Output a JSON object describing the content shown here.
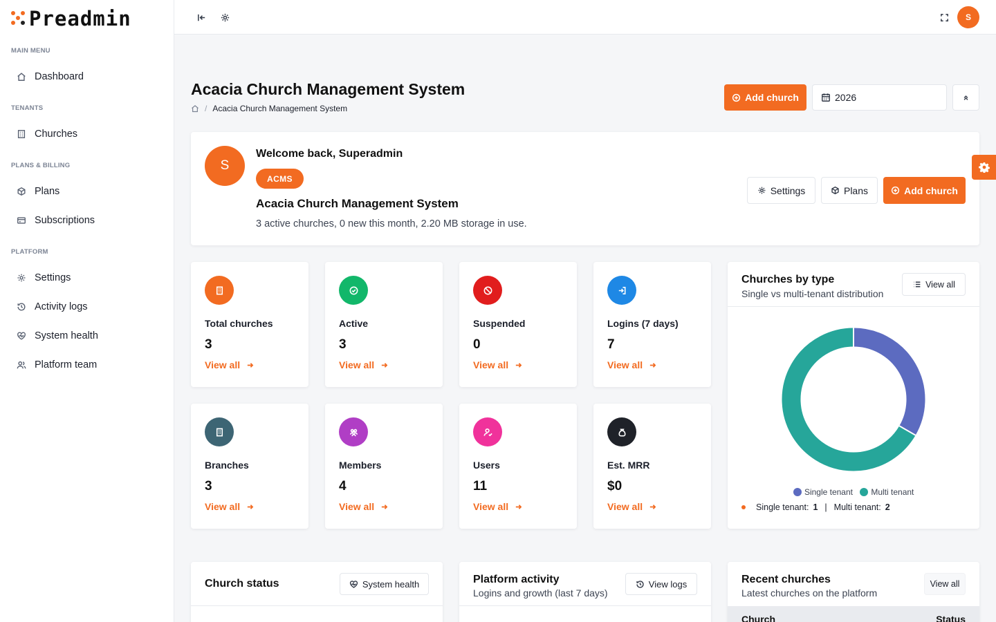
{
  "brand": {
    "name": "Preadmin",
    "accent": "#f26b21"
  },
  "sidebar": {
    "sections": [
      {
        "label": "MAIN MENU",
        "items": [
          {
            "label": "Dashboard",
            "icon": "home-icon"
          }
        ]
      },
      {
        "label": "TENANTS",
        "items": [
          {
            "label": "Churches",
            "icon": "building-icon"
          }
        ]
      },
      {
        "label": "PLANS & BILLING",
        "items": [
          {
            "label": "Plans",
            "icon": "package-icon"
          },
          {
            "label": "Subscriptions",
            "icon": "credit-card-icon"
          }
        ]
      },
      {
        "label": "PLATFORM",
        "items": [
          {
            "label": "Settings",
            "icon": "gear-icon"
          },
          {
            "label": "Activity logs",
            "icon": "history-icon"
          },
          {
            "label": "System health",
            "icon": "heartbeat-icon"
          },
          {
            "label": "Platform team",
            "icon": "users-icon"
          }
        ]
      }
    ]
  },
  "header": {
    "user_initial": "S"
  },
  "page": {
    "title": "Acacia Church Management System",
    "breadcrumb_current": "Acacia Church Management System",
    "add_church_label": "Add church",
    "year_value": "2026"
  },
  "welcome": {
    "avatar_initial": "S",
    "greeting": "Welcome back, Superadmin",
    "badge": "ACMS",
    "org_name": "Acacia Church Management System",
    "summary": "3 active churches, 0 new this month, 2.20 MB storage in use.",
    "settings_label": "Settings",
    "plans_label": "Plans",
    "add_church_label": "Add church"
  },
  "stats": [
    {
      "label": "Total churches",
      "value": "3",
      "link": "View all",
      "color": "#f26b21",
      "icon": "building-icon"
    },
    {
      "label": "Active",
      "value": "3",
      "link": "View all",
      "color": "#12b76a",
      "icon": "check-circle-icon"
    },
    {
      "label": "Suspended",
      "value": "0",
      "link": "View all",
      "color": "#e11d1d",
      "icon": "ban-icon"
    },
    {
      "label": "Logins (7 days)",
      "value": "7",
      "link": "View all",
      "color": "#1e88e5",
      "icon": "login-icon"
    },
    {
      "label": "Branches",
      "value": "3",
      "link": "View all",
      "color": "#3d6574",
      "icon": "building-icon"
    },
    {
      "label": "Members",
      "value": "4",
      "link": "View all",
      "color": "#b03ec5",
      "icon": "users-icon"
    },
    {
      "label": "Users",
      "value": "11",
      "link": "View all",
      "color": "#f0329b",
      "icon": "user-check-icon"
    },
    {
      "label": "Est. MRR",
      "value": "$0",
      "link": "View all",
      "color": "#1f2229",
      "icon": "money-bag-icon"
    }
  ],
  "churches_by_type": {
    "title": "Churches by type",
    "subtitle": "Single vs multi-tenant distribution",
    "view_all_label": "View all",
    "summary_single_label": "Single tenant:",
    "summary_single_value": "1",
    "summary_sep": "|",
    "summary_multi_label": "Multi tenant:",
    "summary_multi_value": "2"
  },
  "chart_data": {
    "type": "pie",
    "categories": [
      "Single tenant",
      "Multi tenant"
    ],
    "values": [
      1,
      2
    ],
    "colors": [
      "#5c6bc0",
      "#26a69a"
    ],
    "legend": "bottom"
  },
  "church_status": {
    "title": "Church status",
    "button_label": "System health"
  },
  "platform_activity": {
    "title": "Platform activity",
    "subtitle": "Logins and growth (last 7 days)",
    "button_label": "View logs"
  },
  "recent_churches": {
    "title": "Recent churches",
    "subtitle": "Latest churches on the platform",
    "button_label": "View all",
    "columns": [
      "Church",
      "Status"
    ]
  }
}
